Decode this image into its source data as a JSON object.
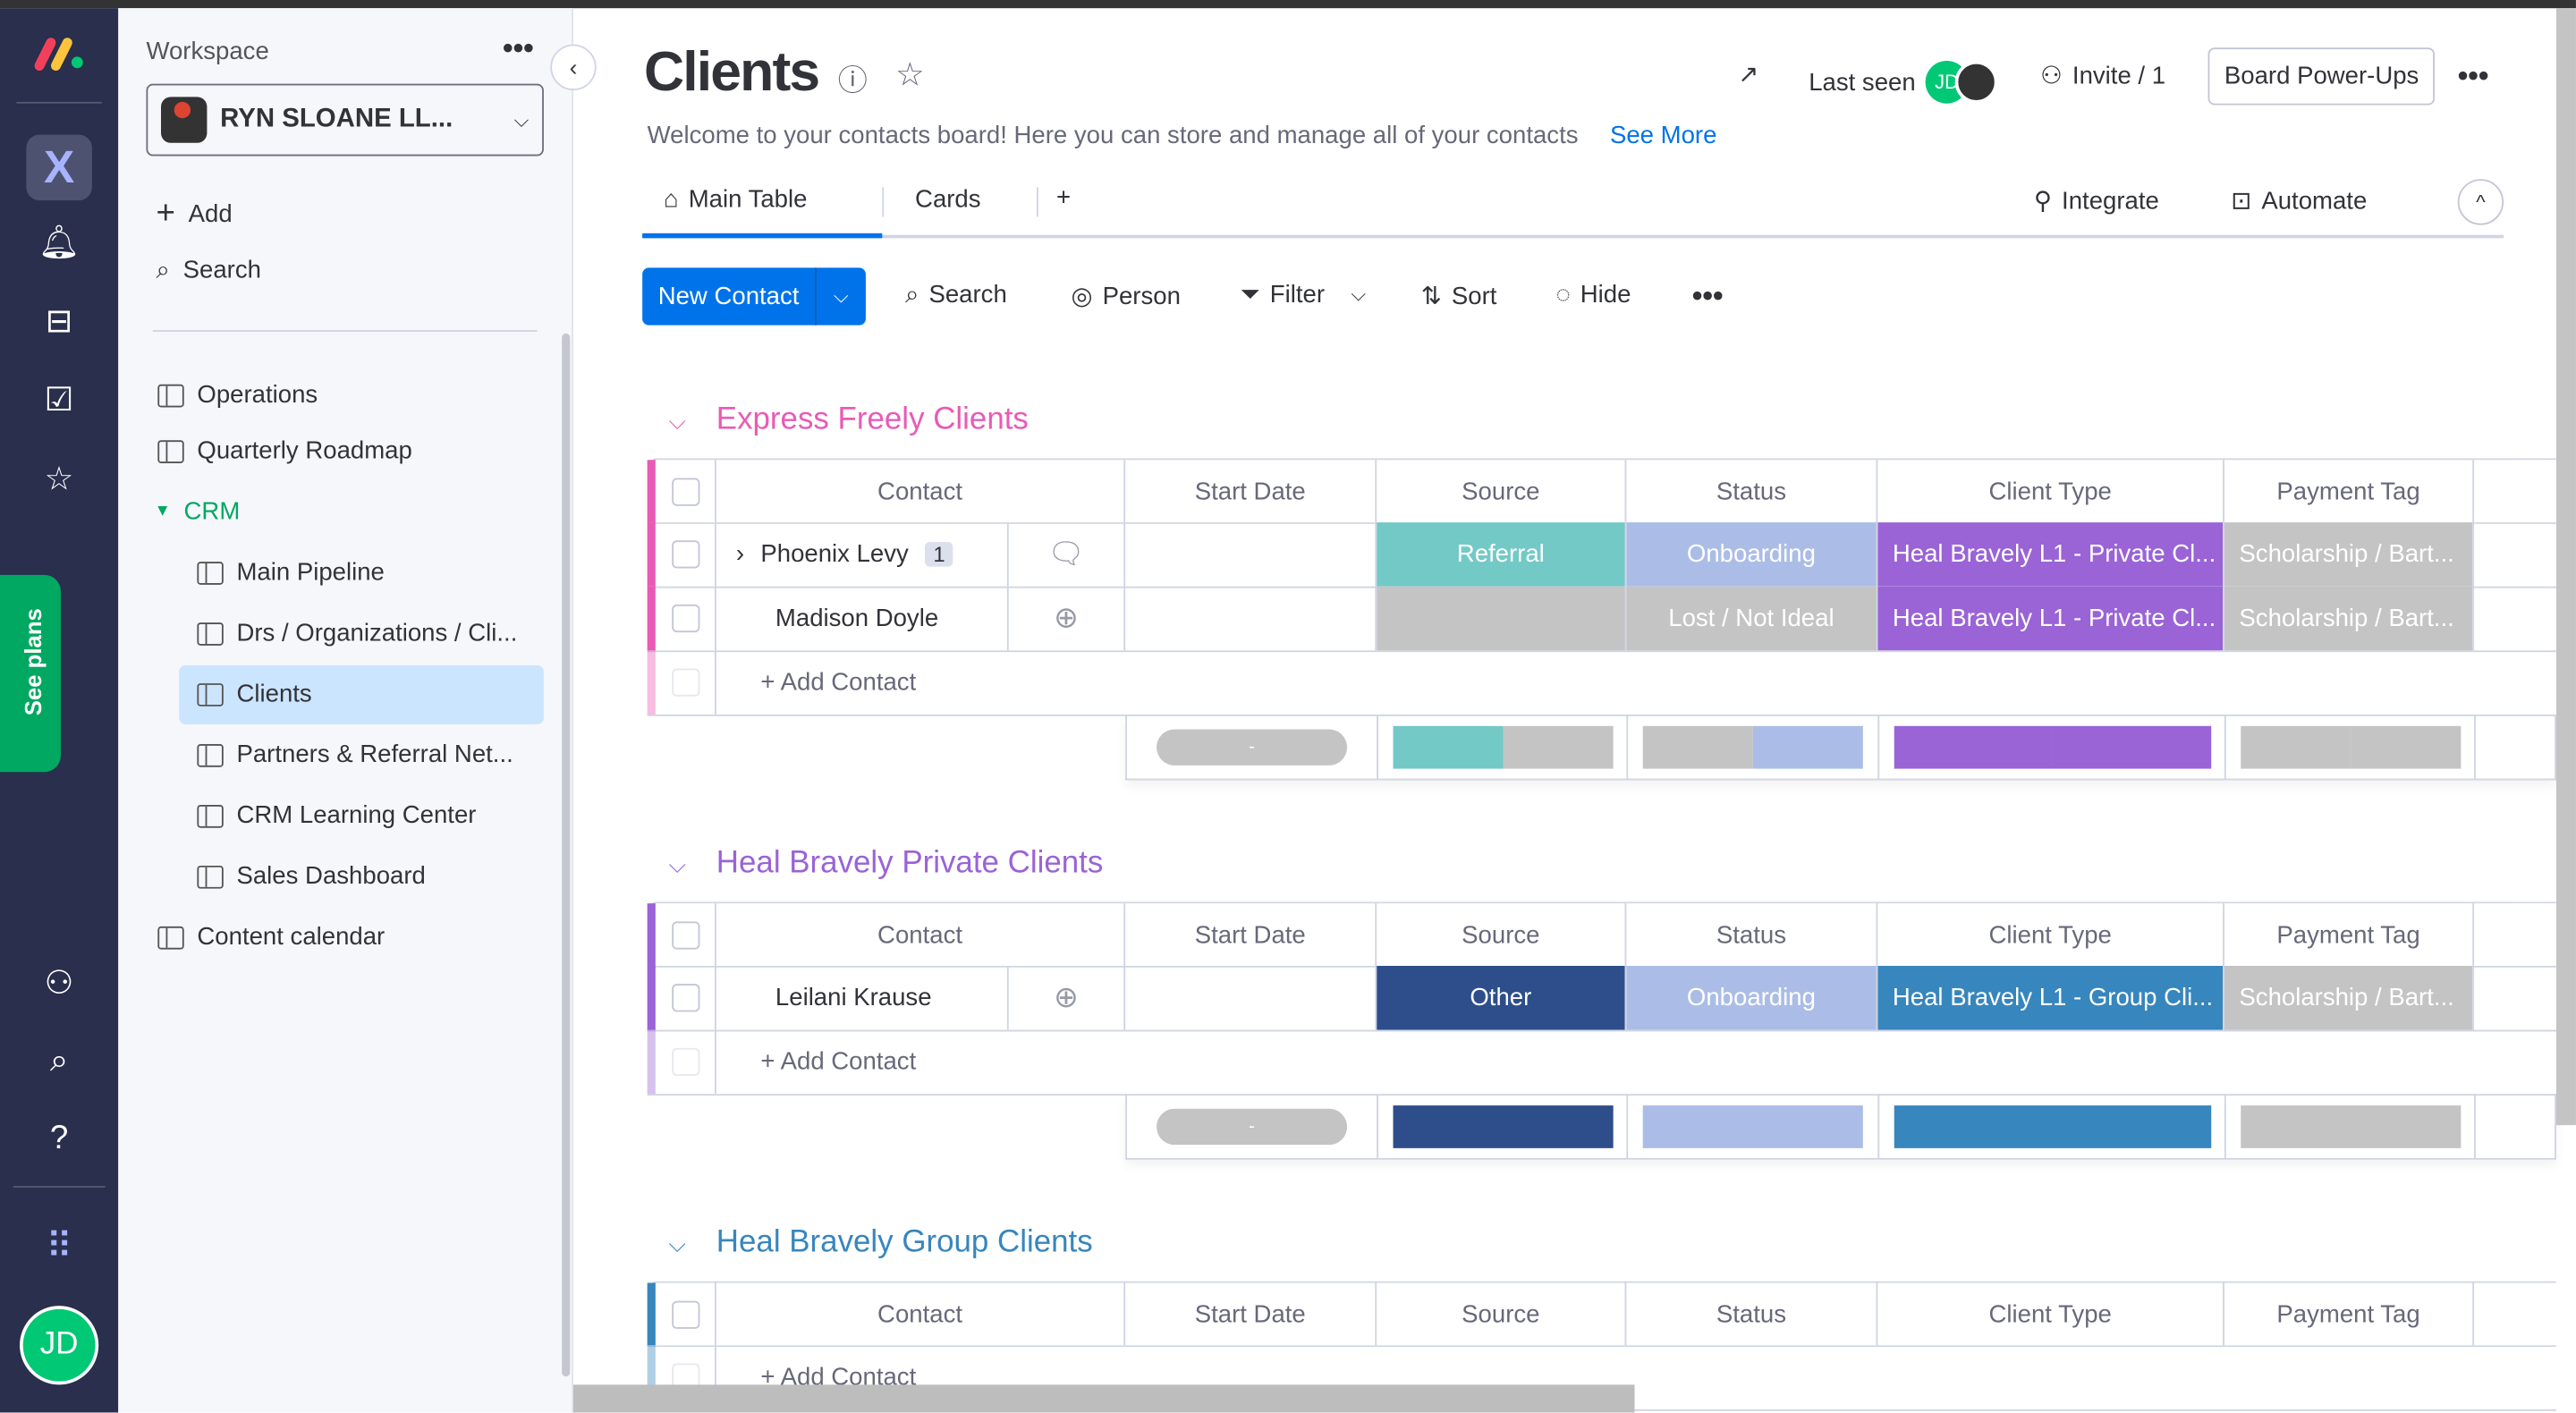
{
  "sidebar": {
    "workspace_label": "Workspace",
    "workspace_name": "RYN SLOANE LL...",
    "add_label": "Add",
    "search_label": "Search",
    "items": [
      {
        "label": "Operations",
        "icon": "board-icon"
      },
      {
        "label": "Quarterly Roadmap",
        "icon": "board-icon"
      },
      {
        "label": "CRM",
        "icon": "folder-caret-icon"
      },
      {
        "label": "Main Pipeline",
        "icon": "board-icon"
      },
      {
        "label": "Drs / Organizations / Cli...",
        "icon": "board-icon"
      },
      {
        "label": "Clients",
        "icon": "board-icon",
        "active": true
      },
      {
        "label": "Partners & Referral Net...",
        "icon": "board-icon"
      },
      {
        "label": "CRM Learning Center",
        "icon": "dashboard-icon"
      },
      {
        "label": "Sales Dashboard",
        "icon": "dashboard-icon"
      },
      {
        "label": "Content calendar",
        "icon": "board-icon"
      }
    ],
    "see_plans": "See plans",
    "avatar": "JD"
  },
  "header": {
    "title": "Clients",
    "description": "Welcome to your contacts board! Here you can store and manage all of your contacts",
    "see_more": "See More",
    "last_seen": "Last seen",
    "last_seen_avatar": "JD",
    "invite": "Invite / 1",
    "power_ups": "Board Power-Ups"
  },
  "tabs": {
    "main_table": "Main Table",
    "cards": "Cards",
    "add": "+",
    "integrate": "Integrate",
    "automate": "Automate"
  },
  "toolbar": {
    "new_contact": "New Contact",
    "search": "Search",
    "person": "Person",
    "filter": "Filter",
    "sort": "Sort",
    "hide": "Hide"
  },
  "columns": [
    "Contact",
    "Start Date",
    "Source",
    "Status",
    "Client Type",
    "Payment Tag"
  ],
  "add_contact": "+ Add Contact",
  "summary_dash": "-",
  "colors": {
    "accent": "#0073ea",
    "teal": "#73c9c6",
    "lavender": "#abbde6",
    "purple": "#9a63d6",
    "gray": "#c4c4c4",
    "navy": "#2d4e8a",
    "blue": "#3786bd",
    "pink": "#e85bb5"
  },
  "groups": [
    {
      "title": "Express Freely Clients",
      "color": "#e85bb5",
      "rows": [
        {
          "contact": "Phoenix Levy",
          "subitems": "1",
          "comments": "1",
          "source": "Referral",
          "source_color": "#73c9c6",
          "status": "Onboarding",
          "status_color": "#abbde6",
          "client_type": "Heal Bravely L1 - Private Cl...",
          "client_type_color": "#9a63d6",
          "payment_tag": "Scholarship / Bart...",
          "payment_color": "#c4c4c4"
        },
        {
          "contact": "Madison Doyle",
          "source": "",
          "source_color": "#c4c4c4",
          "status": "Lost / Not Ideal",
          "status_color": "#c4c4c4",
          "client_type": "Heal Bravely L1 - Private Cl...",
          "client_type_color": "#9a63d6",
          "payment_tag": "Scholarship / Bart...",
          "payment_color": "#c4c4c4"
        }
      ]
    },
    {
      "title": "Heal Bravely Private Clients",
      "color": "#9a63d6",
      "rows": [
        {
          "contact": "Leilani Krause",
          "source": "Other",
          "source_color": "#2d4e8a",
          "status": "Onboarding",
          "status_color": "#abbde6",
          "client_type": "Heal Bravely L1 - Group Cli...",
          "client_type_color": "#3786bd",
          "payment_tag": "Scholarship / Bart...",
          "payment_color": "#c4c4c4"
        }
      ]
    },
    {
      "title": "Heal Bravely Group Clients",
      "color": "#3786bd",
      "rows": []
    }
  ]
}
